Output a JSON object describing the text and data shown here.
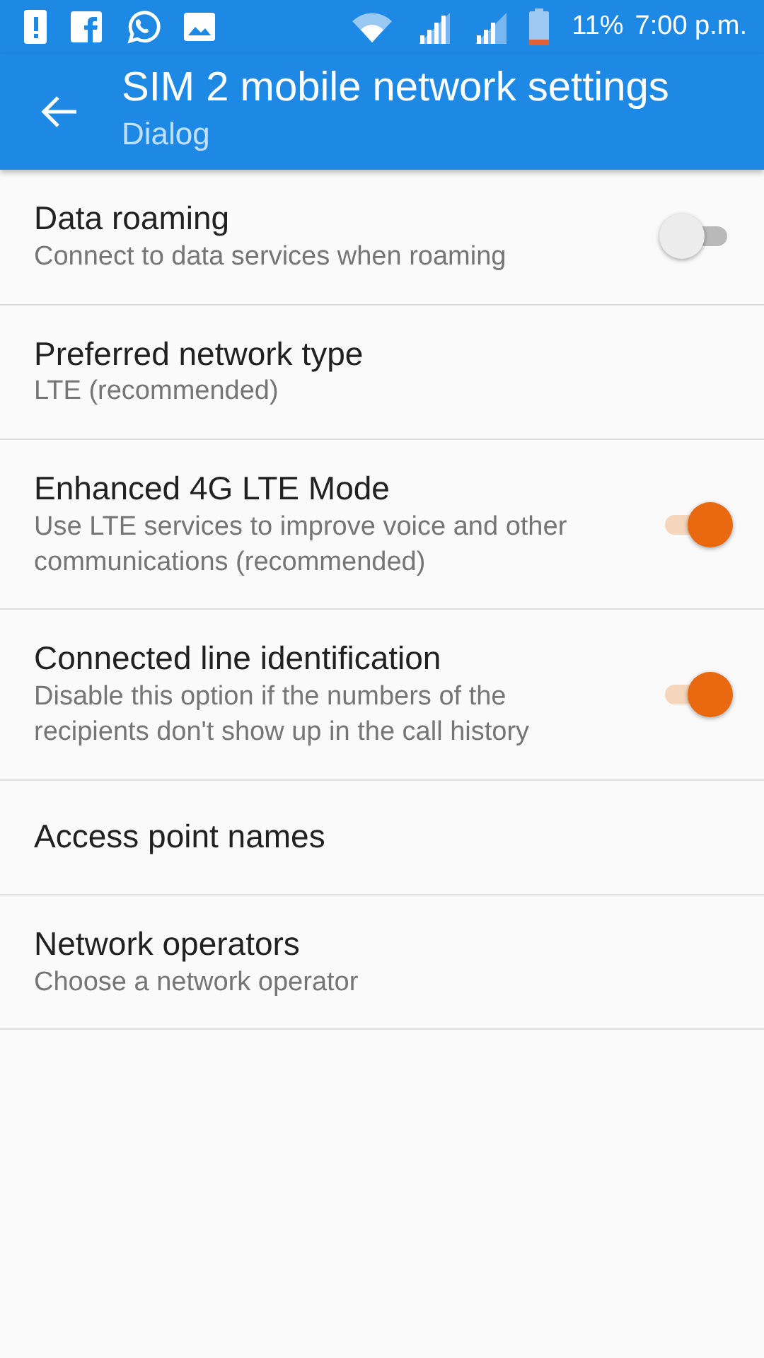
{
  "status_bar": {
    "battery": "11%",
    "time": "7:00 p.m."
  },
  "toolbar": {
    "title": "SIM 2 mobile network settings",
    "subtitle": "Dialog"
  },
  "settings": [
    {
      "kind": "switch",
      "title": "Data roaming",
      "summary": "Connect to data services when roaming",
      "on": false
    },
    {
      "kind": "plain",
      "title": "Preferred network type",
      "summary": "LTE (recommended)"
    },
    {
      "kind": "switch",
      "title": "Enhanced 4G LTE Mode",
      "summary": "Use LTE services to improve voice and other communications (recommended)",
      "on": true
    },
    {
      "kind": "switch",
      "title": "Connected line identification",
      "summary": "Disable this option if the numbers of the recipients don't show up in the call history",
      "on": true
    },
    {
      "kind": "plain",
      "title": "Access point names"
    },
    {
      "kind": "plain",
      "title": "Network operators",
      "summary": "Choose a network operator"
    }
  ]
}
